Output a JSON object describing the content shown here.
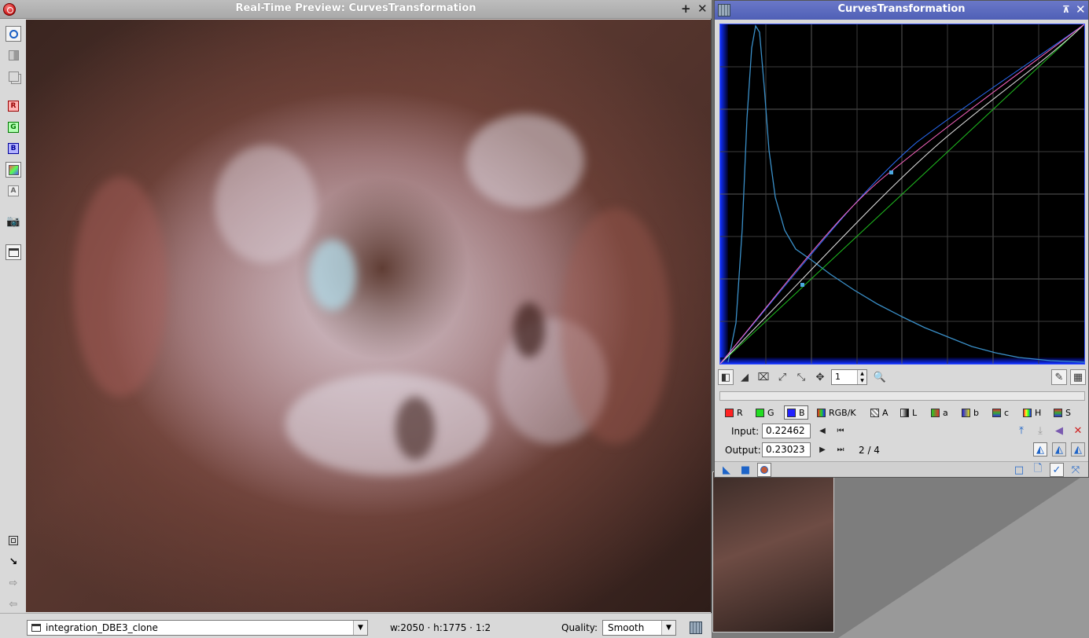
{
  "preview": {
    "title": "Real-Time Preview: CurvesTransformation",
    "view_select": "integration_DBE3_clone",
    "image_info": "w:2050 · h:1775 · 1:2",
    "quality_label": "Quality:",
    "quality_value": "Smooth"
  },
  "toolbar": {
    "channel_r": "R",
    "channel_g": "G",
    "channel_b": "B",
    "channel_a": "A"
  },
  "curves": {
    "title": "CurvesTransformation",
    "zoom_value": "1",
    "channels": [
      {
        "label": "R",
        "color": "#ff2020"
      },
      {
        "label": "G",
        "color": "#20dd20"
      },
      {
        "label": "B",
        "color": "#2020ff"
      },
      {
        "label": "RGB/K",
        "color": "#888888"
      },
      {
        "label": "A",
        "color": "#cccccc"
      },
      {
        "label": "L",
        "color": "#444444"
      },
      {
        "label": "a",
        "color": "#d04020"
      },
      {
        "label": "b",
        "color": "#2040d0"
      },
      {
        "label": "c",
        "color": "#a060a0"
      },
      {
        "label": "H",
        "color": "#c08020"
      },
      {
        "label": "S",
        "color": "#8060a0"
      }
    ],
    "active_channel": "B",
    "input_label": "Input:",
    "input_value": "0.22462",
    "output_label": "Output:",
    "output_value": "0.23023",
    "point_index": "2 / 4"
  }
}
